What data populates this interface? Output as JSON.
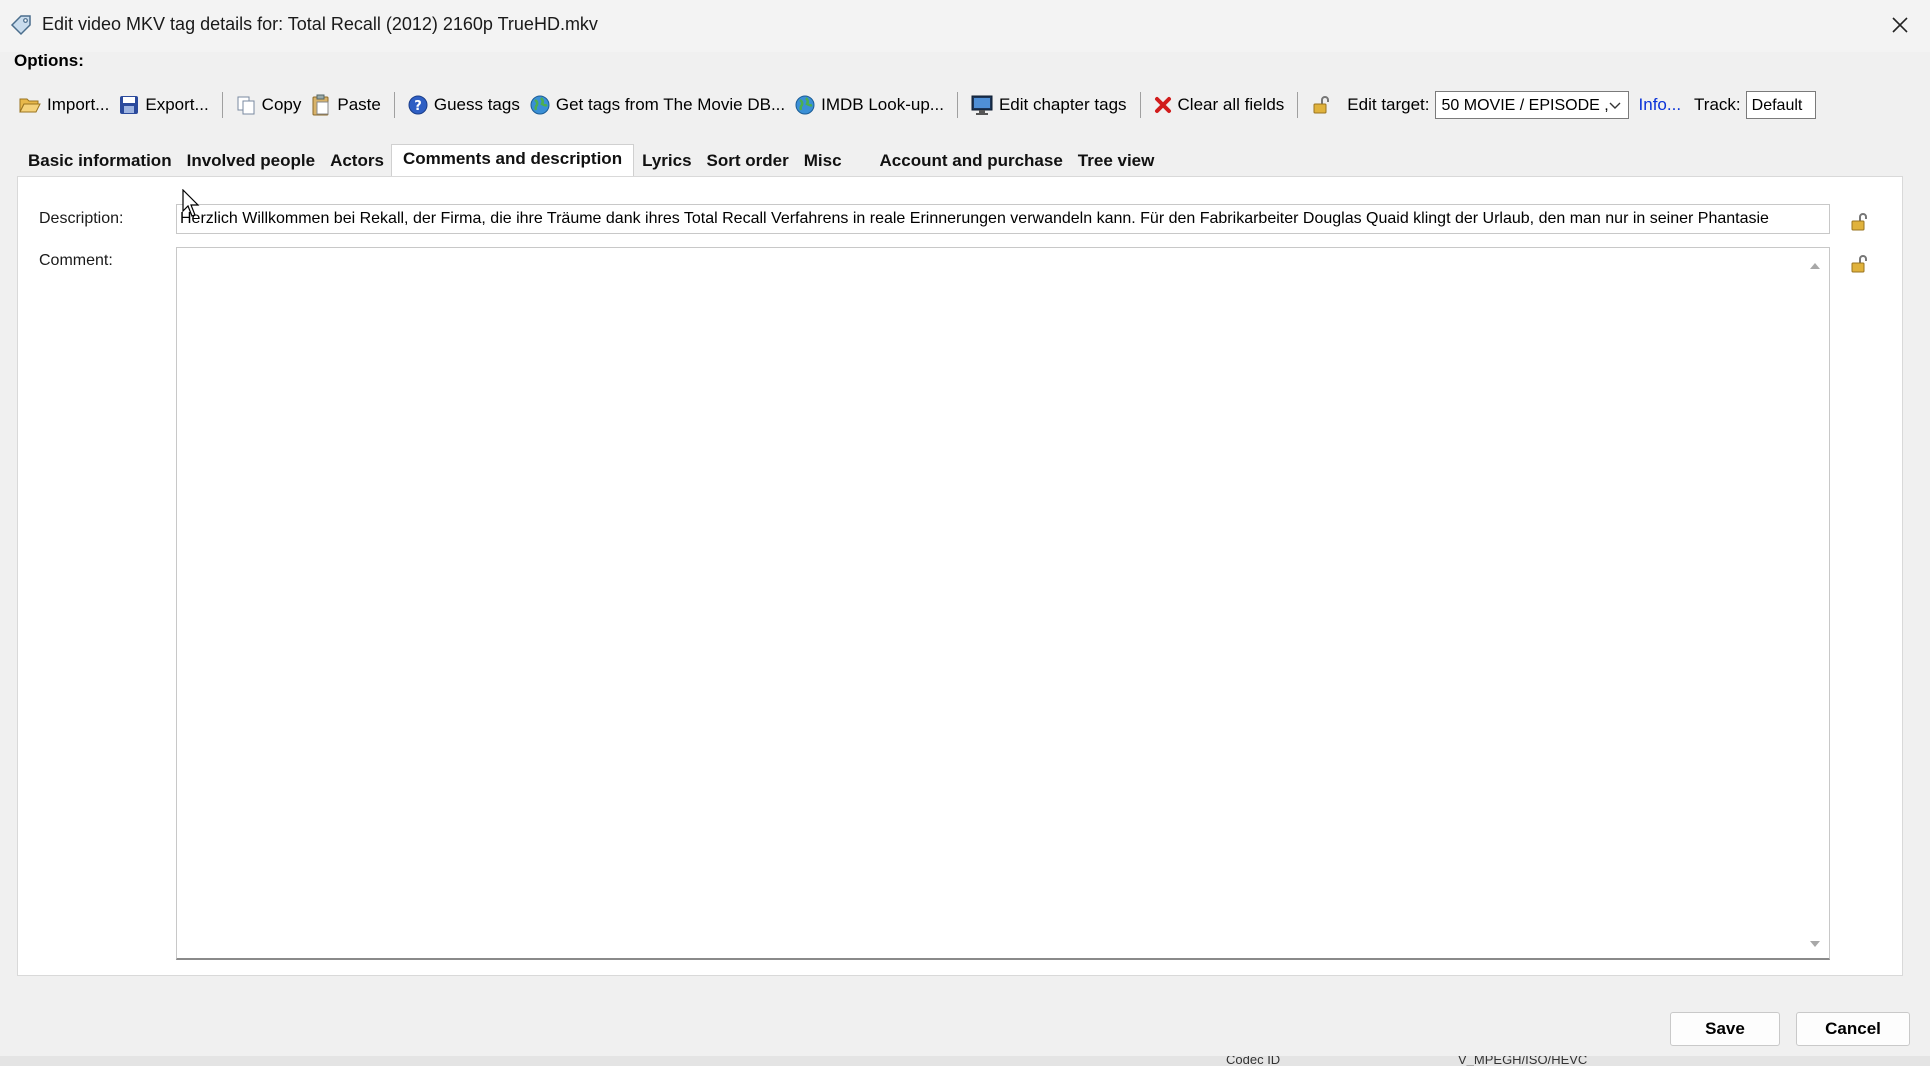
{
  "window": {
    "title": "Edit video MKV tag details for: Total Recall (2012) 2160p TrueHD.mkv"
  },
  "options_label": "Options:",
  "toolbar": {
    "import_label": "Import...",
    "export_label": "Export...",
    "copy_label": "Copy",
    "paste_label": "Paste",
    "guess_label": "Guess tags",
    "moviedb_label": "Get tags from The Movie DB...",
    "imdb_label": "IMDB Look-up...",
    "chapter_label": "Edit chapter tags",
    "clear_label": "Clear all fields",
    "edit_target_label": "Edit target:",
    "edit_target_value": "50 MOVIE / EPISODE ,",
    "info_label": "Info...",
    "track_label": "Track:",
    "track_value": "Default"
  },
  "tabs": [
    {
      "label": "Basic information",
      "active": false
    },
    {
      "label": "Involved people",
      "active": false
    },
    {
      "label": "Actors",
      "active": false
    },
    {
      "label": "Comments and description",
      "active": true
    },
    {
      "label": "Lyrics",
      "active": false
    },
    {
      "label": "Sort order",
      "active": false
    },
    {
      "label": "Misc",
      "active": false
    },
    {
      "label": "Account and purchase",
      "active": false
    },
    {
      "label": "Tree view",
      "active": false
    }
  ],
  "form": {
    "description_label": "Description:",
    "description_value": "Herzlich Willkommen bei Rekall, der Firma, die ihre Träume dank ihres Total Recall Verfahrens in reale Erinnerungen verwandeln kann. Für den Fabrikarbeiter Douglas Quaid klingt der Urlaub, den man nur in seiner Phantasie",
    "comment_label": "Comment:",
    "comment_value": ""
  },
  "buttons": {
    "save_label": "Save",
    "cancel_label": "Cancel"
  },
  "background": {
    "codec_label": "Codec ID",
    "codec_value": "V_MPEGH/ISO/HEVC"
  },
  "colors": {
    "link": "#0a32d8",
    "clear_icon": "#d11c1c",
    "lock": "#d4a017"
  }
}
